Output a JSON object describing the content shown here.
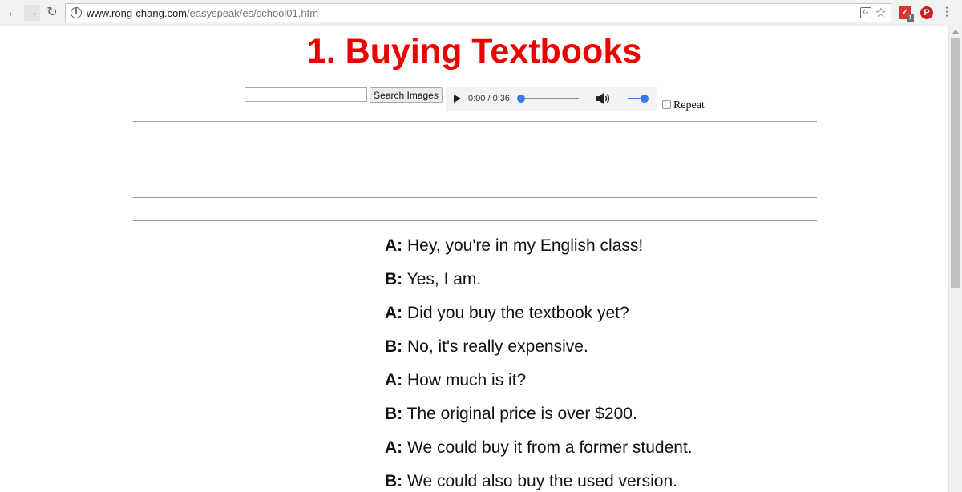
{
  "browser": {
    "url_host": "www.rong-chang.com",
    "url_path": "/easyspeak/es/school01.htm",
    "extension_badge": "1",
    "icons": {
      "back": "back-arrow-icon",
      "forward": "forward-arrow-icon",
      "reload": "reload-icon",
      "info": "info-icon",
      "translate": "translate-icon",
      "bookmark": "star-icon",
      "extension": "extension-icon",
      "pinterest": "pinterest-icon",
      "menu": "menu-icon"
    }
  },
  "page": {
    "title": "1. Buying Textbooks",
    "title_color": "#ee0000",
    "search": {
      "input_value": "",
      "button_label": "Search Images"
    },
    "audio": {
      "time": "0:00 / 0:36",
      "progress": 0,
      "volume": 1.0,
      "accent": "#3b78e7"
    },
    "repeat_label": "Repeat",
    "repeat_checked": false,
    "dialogue": [
      {
        "speaker": "A:",
        "text": "Hey, you're in my English class!"
      },
      {
        "speaker": "B:",
        "text": "Yes, I am."
      },
      {
        "speaker": "A:",
        "text": "Did you buy the textbook yet?"
      },
      {
        "speaker": "B:",
        "text": "No, it's really expensive."
      },
      {
        "speaker": "A:",
        "text": "How much is it?"
      },
      {
        "speaker": "B:",
        "text": "The original price is over $200."
      },
      {
        "speaker": "A:",
        "text": "We could buy it from a former student."
      },
      {
        "speaker": "B:",
        "text": "We could also buy the used version."
      }
    ]
  }
}
